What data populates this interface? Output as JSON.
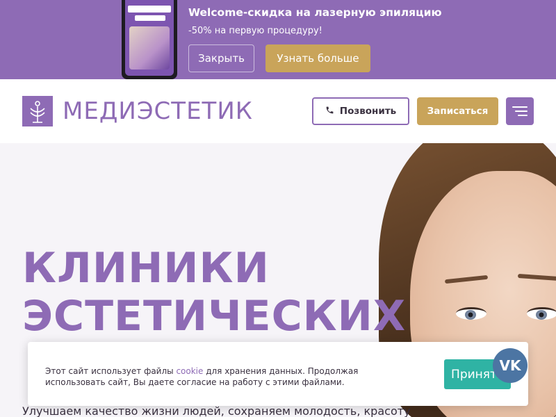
{
  "promo": {
    "title": "Welcome-скидка на лазерную эпиляцию",
    "subtitle": "-50% на первую процедуру!",
    "close_label": "Закрыть",
    "more_label": "Узнать больше"
  },
  "header": {
    "logo_text": "МЕДИЭСТЕТИК",
    "call_label": "Позвонить",
    "book_label": "Записаться"
  },
  "hero": {
    "title_line1": "КЛИНИКИ",
    "title_line2": "ЭСТЕТИЧЕСКИХ",
    "description": "Улучшаем качество жизни людей, сохраняем молодость, красоту"
  },
  "cookie": {
    "text_before": "Этот сайт использует файлы ",
    "link_text": "cookie",
    "text_after": " для хранения данных. Продолжая использовать сайт, Вы даете согласие на работу с этими файлами.",
    "accept_label": "Принять"
  },
  "social": {
    "vk_label": "VK"
  },
  "colors": {
    "brand_purple": "#8e6bb5",
    "gold": "#c9a45a",
    "teal": "#2fb3a4",
    "vk_blue": "#4c75a3"
  }
}
